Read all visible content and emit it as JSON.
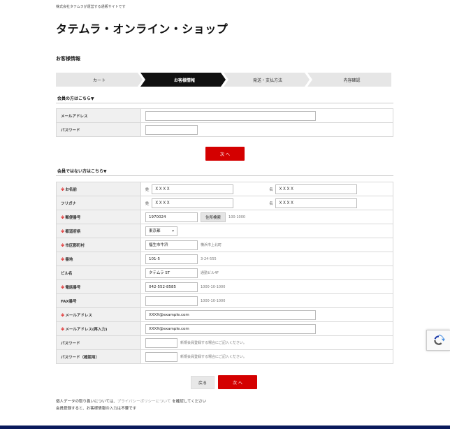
{
  "header": {
    "tagline": "株式会社タテムラが運営する通販サイトです",
    "brand": "タテムラ・オンライン・ショップ"
  },
  "page_title": "お客様情報",
  "steps": [
    "カート",
    "お客様情報",
    "発送・支払方法",
    "内容確認"
  ],
  "member": {
    "heading": "会員の方はこちら▼",
    "email_label": "メールアドレス",
    "password_label": "パスワード",
    "next_label": "次 へ"
  },
  "guest": {
    "heading": "会員ではない方はこちら▼",
    "required_mark": "※",
    "name": {
      "label": "お名前",
      "sei_pre": "姓",
      "sei_value": "ＸＸＸＸ",
      "mei_pre": "名",
      "mei_value": "ＸＸＸＸ"
    },
    "kana": {
      "label": "フリガナ",
      "sei_pre": "姓",
      "sei_value": "ＸＸＸＸ",
      "mei_pre": "名",
      "mei_value": "ＸＸＸＸ"
    },
    "zip": {
      "label": "郵便番号",
      "value": "1970024",
      "button": "住所検索",
      "hint": "100-1000"
    },
    "pref": {
      "label": "都道府県",
      "value": "東京都"
    },
    "city": {
      "label": "市区郡町村",
      "value": "福生市牛浜",
      "hint": "横浜市上北町"
    },
    "banchi": {
      "label": "番地",
      "value": "101-5",
      "hint": "3-24-555"
    },
    "building": {
      "label": "ビル名",
      "value": "タテムラ ST",
      "hint": "通勤ビル4F"
    },
    "tel": {
      "label": "電話番号",
      "value": "042-552-8585",
      "hint": "1000-10-1000"
    },
    "fax": {
      "label": "FAX番号",
      "value": "",
      "hint": "1000-10-1000"
    },
    "email": {
      "label": "メールアドレス",
      "value": "XXXX@example.com"
    },
    "email2": {
      "label": "メールアドレス(再入力)",
      "value": "XXXX@example.com"
    },
    "password": {
      "label": "パスワード",
      "hint": "新規会員登録する場合にご記入ください。"
    },
    "password2": {
      "label": "パスワード（確認用）",
      "hint": "新規会員登録する場合にご記入ください。"
    },
    "back_label": "戻る",
    "next_label": "次 へ"
  },
  "footer_notes": {
    "line1_pre": "個人データの取り扱いについては、",
    "line1_link": "プライバシーポリシーについて",
    "line1_post": " を確認してください",
    "line2": "会員登録すると、お客様情報の入力は不要です"
  },
  "colors": {
    "accent": "#d40000",
    "step_active": "#111111",
    "footer": "#0a1b5c"
  }
}
